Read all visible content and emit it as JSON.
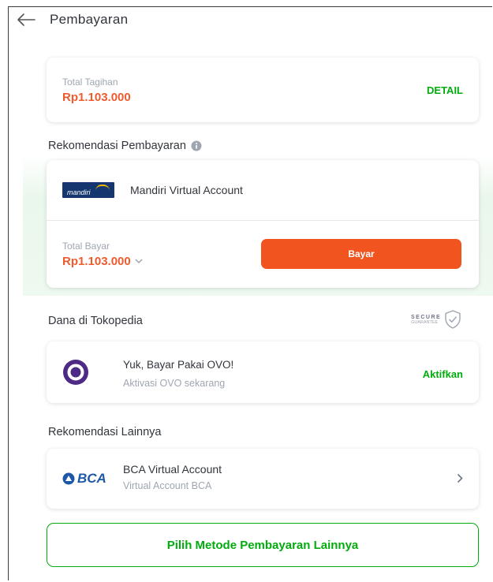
{
  "header": {
    "title": "Pembayaran"
  },
  "total_tagihan": {
    "label": "Total Tagihan",
    "amount": "Rp1.103.000",
    "detail_link": "DETAIL"
  },
  "rekomendasi": {
    "section_title": "Rekomendasi Pembayaran",
    "method": {
      "logo_text": "mandiri",
      "name": "Mandiri Virtual Account"
    },
    "total_bayar_label": "Total Bayar",
    "total_bayar_amount": "Rp1.103.000",
    "pay_button": "Bayar"
  },
  "dana": {
    "section_title": "Dana di Tokopedia",
    "secure_text_1": "SECURE",
    "secure_text_2": "GUARANTEE",
    "ovo": {
      "title": "Yuk, Bayar Pakai OVO!",
      "subtitle": "Aktivasi OVO sekarang",
      "action": "Aktifkan"
    }
  },
  "lainnya": {
    "section_title": "Rekomendasi Lainnya",
    "bca": {
      "logo_text": "BCA",
      "title": "BCA Virtual Account",
      "subtitle": "Virtual Account BCA"
    }
  },
  "other_methods_button": "Pilih Metode Pembayaran Lainnya",
  "colors": {
    "accent_orange": "#f2541f",
    "price_orange": "#ef5b2c",
    "brand_green": "#03ac0e",
    "bca_blue": "#1d58a8",
    "ovo_purple": "#4c2a86"
  }
}
